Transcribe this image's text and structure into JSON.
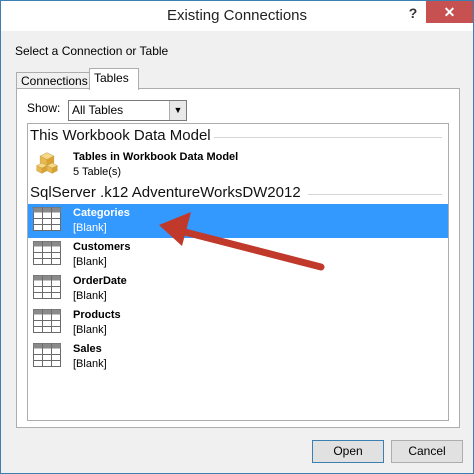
{
  "window": {
    "title": "Existing Connections",
    "help": "?",
    "close": "✕"
  },
  "section_label": "Select a Connection or Table",
  "tabs": [
    {
      "label": "Connections"
    },
    {
      "label": "Tables"
    }
  ],
  "show": {
    "label": "Show:",
    "value": "All Tables"
  },
  "groups": [
    {
      "header": "This Workbook Data Model",
      "items": [
        {
          "name": "Tables in Workbook Data Model",
          "sub": "5 Table(s)",
          "icon": "data-model-cubes-icon"
        }
      ]
    },
    {
      "header": "SqlServer .k12 AdventureWorksDW2012",
      "items": [
        {
          "name": "Categories",
          "sub": "[Blank]",
          "icon": "table-icon",
          "selected": true
        },
        {
          "name": "Customers",
          "sub": "[Blank]",
          "icon": "table-icon"
        },
        {
          "name": "OrderDate",
          "sub": "[Blank]",
          "icon": "table-icon"
        },
        {
          "name": "Products",
          "sub": "[Blank]",
          "icon": "table-icon"
        },
        {
          "name": "Sales",
          "sub": "[Blank]",
          "icon": "table-icon"
        }
      ]
    }
  ],
  "buttons": {
    "open": "Open",
    "cancel": "Cancel"
  },
  "colors": {
    "selection": "#3399ff",
    "annotation_arrow": "#c0392b",
    "close_button": "#c75050"
  }
}
